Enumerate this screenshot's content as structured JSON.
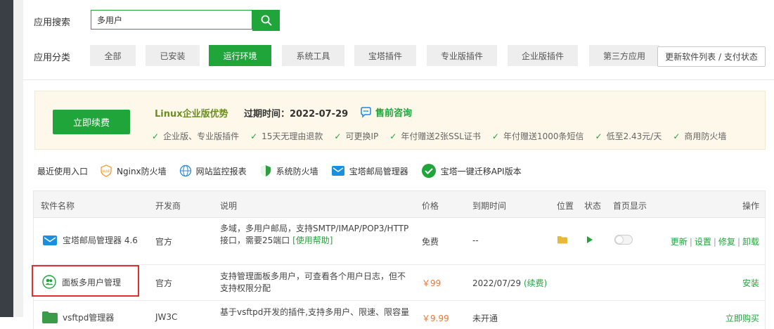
{
  "search": {
    "label": "应用搜索",
    "value": "多用户"
  },
  "categories": {
    "label": "应用分类",
    "items": [
      "全部",
      "已安装",
      "运行环境",
      "系统工具",
      "宝塔插件",
      "专业版插件",
      "企业版插件",
      "第三方应用"
    ],
    "active": "运行环境",
    "refresh_label": "更新软件列表 / 支付状态"
  },
  "banner": {
    "renew_label": "立即续费",
    "title": "Linux企业版优势",
    "expire": "过期时间：2022-07-29",
    "consult": "售前咨询",
    "features": [
      "企业版、专业版插件",
      "15天无理由退款",
      "可更换IP",
      "年付赠送2张SSL证书",
      "年付赠送1000条短信",
      "低至2.43元/天",
      "商用防火墙"
    ]
  },
  "recent": {
    "label": "最近使用入口",
    "items": [
      "Nginx防火墙",
      "网站监控报表",
      "系统防火墙",
      "宝塔邮局管理器",
      "宝塔一键迁移API版本"
    ]
  },
  "table": {
    "headers": {
      "name": "软件名称",
      "developer": "开发商",
      "desc": "说明",
      "price": "价格",
      "expire": "到期时间",
      "location": "位置",
      "status": "状态",
      "homepage": "首页显示",
      "ops": "操作"
    },
    "rows": [
      {
        "name": "宝塔邮局管理器 4.6",
        "developer": "官方",
        "desc": "多域，多用户邮局，支持SMTP/IMAP/POP3/HTTP接口，需要25端口",
        "desc_link": "[使用帮助]",
        "price": "免费",
        "expire": "--",
        "ops": [
          "更新",
          "设置",
          "修复",
          "卸载"
        ]
      },
      {
        "name": "面板多用户管理",
        "developer": "官方",
        "desc": "支持管理面板多用户，可查看各个用户日志，但不支持权限分配",
        "price": "￥99",
        "expire": "2022/07/29",
        "expire_link": "(续费)",
        "ops": [
          "安装"
        ]
      },
      {
        "name": "vsftpd管理器",
        "developer": "JW3C",
        "desc": "基于vsftpd开发的插件,支持多用户、限速、限容量",
        "price": "￥9.99",
        "expire": "未开通",
        "ops": [
          "立即购买"
        ]
      }
    ]
  },
  "colors": {
    "accent": "#20a53a",
    "price": "#f0742f",
    "highlight": "#e0302e"
  }
}
